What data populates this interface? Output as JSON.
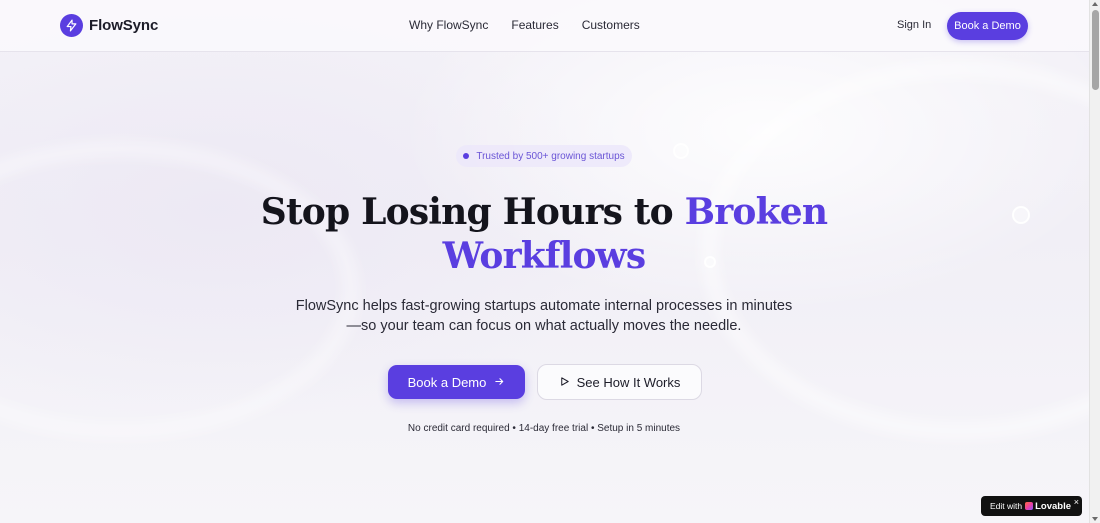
{
  "header": {
    "brand": "FlowSync",
    "nav": [
      "Why FlowSync",
      "Features",
      "Customers"
    ],
    "sign_in": "Sign In",
    "book_demo": "Book a Demo"
  },
  "hero": {
    "badge": "Trusted by 500+ growing startups",
    "headline_part1": "Stop Losing Hours to",
    "headline_accent1": "Broken",
    "headline_accent2": "Workflows",
    "subheadline_line1": "FlowSync helps fast-growing startups automate internal processes in minutes",
    "subheadline_line2": "—so your team can focus on what actually moves the needle.",
    "cta_primary": "Book a Demo",
    "cta_secondary": "See How It Works",
    "fine_print": "No credit card required • 14-day free trial • Setup in 5 minutes"
  },
  "lovable_badge": {
    "prefix": "Edit with",
    "brand": "Lovable",
    "close": "×"
  },
  "colors": {
    "accent": "#5a3ee0",
    "background": "#f4f2f8",
    "text": "#14141c"
  },
  "icons": {
    "logo": "lightning-bolt-icon",
    "arrow": "arrow-right-icon",
    "play": "play-icon"
  }
}
